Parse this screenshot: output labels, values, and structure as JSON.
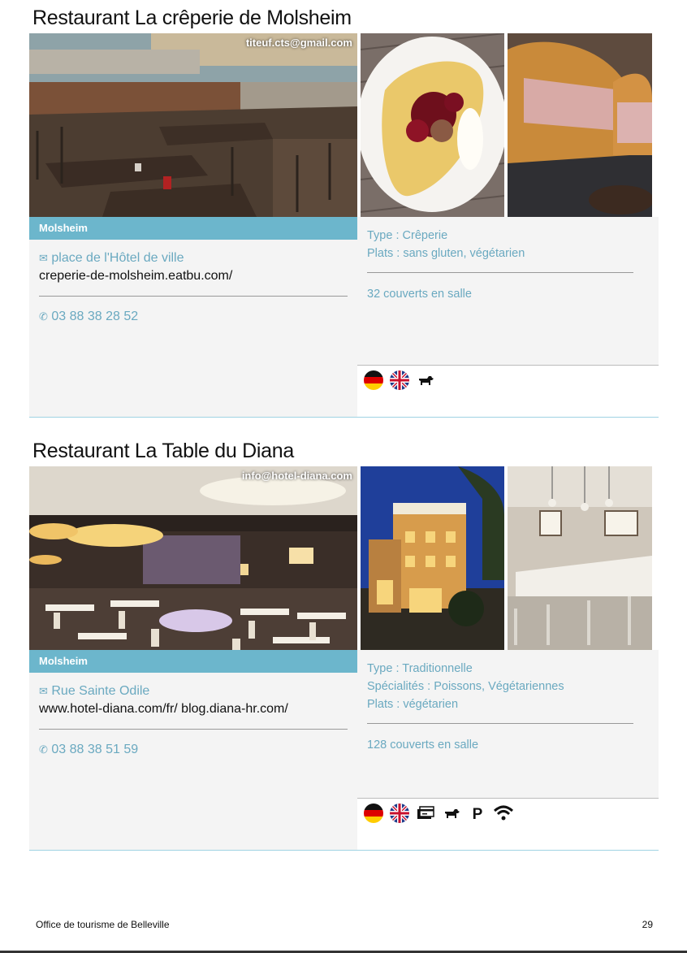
{
  "entries": [
    {
      "title": "Restaurant La crêperie de Molsheim",
      "email": "titeuf.cts@gmail.com",
      "town": "Molsheim",
      "address": "place de l'Hôtel de ville",
      "website": "creperie-de-molsheim.eatbu.com/",
      "phone": "03 88 38 28 52",
      "info": [
        "Type : Crêperie",
        "Plats : sans gluten, végétarien"
      ],
      "capacity": "32 couverts en salle",
      "icons": [
        "german-flag-icon",
        "uk-flag-icon",
        "dog-icon"
      ]
    },
    {
      "title": "Restaurant La Table du Diana",
      "email": "info@hotel-diana.com",
      "town": "Molsheim",
      "address": "Rue Sainte Odile",
      "website": "www.hotel-diana.com/fr/ blog.diana-hr.com/",
      "phone": "03 88 38 51 59",
      "info": [
        "Type : Traditionnelle",
        "Spécialités : Poissons, Végétariennes",
        "Plats : végétarien"
      ],
      "capacity": "128 couverts en salle",
      "icons": [
        "german-flag-icon",
        "uk-flag-icon",
        "credit-card-icon",
        "dog-icon",
        "parking-icon",
        "wifi-icon"
      ]
    }
  ],
  "footer": {
    "office": "Office de tourisme de Belleville",
    "page": "29"
  },
  "colors": {
    "accent": "#6aa9c0",
    "townbar": "#6cb6cc"
  }
}
